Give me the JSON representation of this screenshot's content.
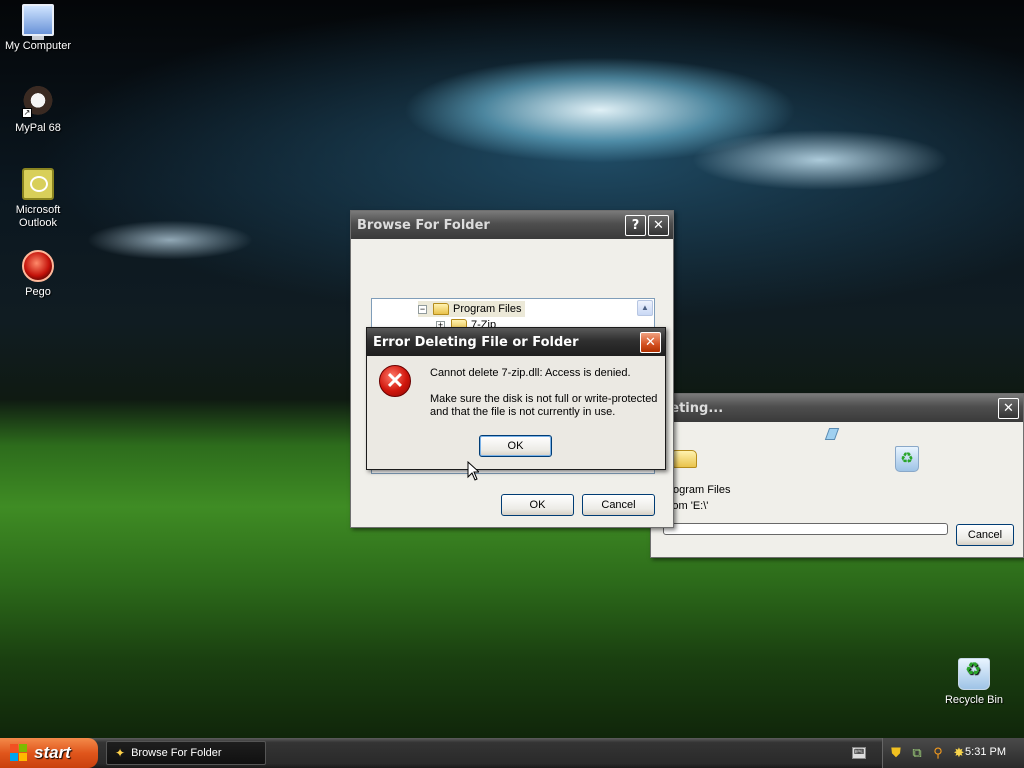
{
  "desktop": {
    "icons": [
      {
        "label": "My Computer",
        "icon": "my-computer-icon"
      },
      {
        "label": "MyPal 68",
        "icon": "mypal-icon"
      },
      {
        "label": "Microsoft Outlook",
        "icon": "outlook-icon"
      },
      {
        "label": "Pego",
        "icon": "pego-icon"
      },
      {
        "label": "Recycle Bin",
        "icon": "recycle-bin-icon"
      }
    ]
  },
  "browse_dialog": {
    "title": "Browse For Folder",
    "help_label": "?",
    "close_label": "✕",
    "tree": [
      {
        "label": "Program Files",
        "expander": "−"
      },
      {
        "label": "7-Zip",
        "expander": "+"
      }
    ],
    "ok_label": "OK",
    "cancel_label": "Cancel"
  },
  "error_dialog": {
    "title": "Error Deleting File or Folder",
    "close_label": "✕",
    "message": "Cannot delete 7-zip.dll: Access is denied.",
    "detail_line1": "Make sure the disk is not full or write-protected",
    "detail_line2": "and that the file is not currently in use.",
    "ok_label": "OK"
  },
  "deleting_dialog": {
    "title": "eleting...",
    "close_label": "✕",
    "item": "Program Files",
    "from": "From 'E:\\'",
    "cancel_label": "Cancel",
    "progress": 0
  },
  "taskbar": {
    "start_label": "start",
    "task_label": "Browse For Folder",
    "clock": "5:31 PM"
  },
  "colors": {
    "start_button": "#e0561c",
    "error_icon": "#d0160c"
  }
}
